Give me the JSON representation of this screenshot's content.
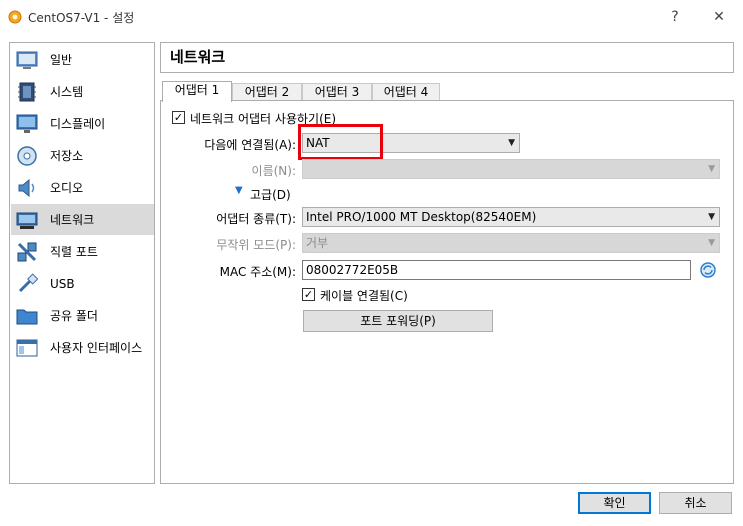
{
  "window": {
    "title": "CentOS7-V1 - 설정",
    "help_label": "?",
    "close_label": "✕"
  },
  "sidebar": {
    "items": [
      {
        "label": "일반",
        "icon": "general-icon"
      },
      {
        "label": "시스템",
        "icon": "system-chip-icon"
      },
      {
        "label": "디스플레이",
        "icon": "display-monitor-icon"
      },
      {
        "label": "저장소",
        "icon": "storage-disc-icon"
      },
      {
        "label": "오디오",
        "icon": "audio-speaker-icon"
      },
      {
        "label": "네트워크",
        "icon": "network-icon",
        "selected": true
      },
      {
        "label": "직렬 포트",
        "icon": "serial-port-icon"
      },
      {
        "label": "USB",
        "icon": "usb-icon"
      },
      {
        "label": "공유 폴더",
        "icon": "shared-folder-icon"
      },
      {
        "label": "사용자 인터페이스",
        "icon": "user-interface-icon"
      }
    ]
  },
  "page_title": "네트워크",
  "tabs": [
    "어댑터 1",
    "어댑터 2",
    "어댑터 3",
    "어댑터 4"
  ],
  "adapter": {
    "enable_label": "네트워크 어댑터 사용하기(E)",
    "enable_checked": true,
    "attached_label": "다음에 연결됨(A):",
    "attached_value": "NAT",
    "name_label": "이름(N):",
    "name_value": "",
    "advanced_label": "고급(D)",
    "adapter_type_label": "어댑터 종류(T):",
    "adapter_type_value": "Intel PRO/1000 MT Desktop(82540EM)",
    "promiscuous_label": "무작위 모드(P):",
    "promiscuous_value": "거부",
    "mac_label": "MAC 주소(M):",
    "mac_value": "08002772E05B",
    "cable_label": "케이블 연결됨(C)",
    "cable_checked": true,
    "port_forwarding_label": "포트 포워딩(P)"
  },
  "footer": {
    "ok_label": "확인",
    "cancel_label": "취소"
  },
  "colors": {
    "highlight_box": "#e8000b",
    "selected_item": "#dadada",
    "accent": "#0078d7"
  }
}
